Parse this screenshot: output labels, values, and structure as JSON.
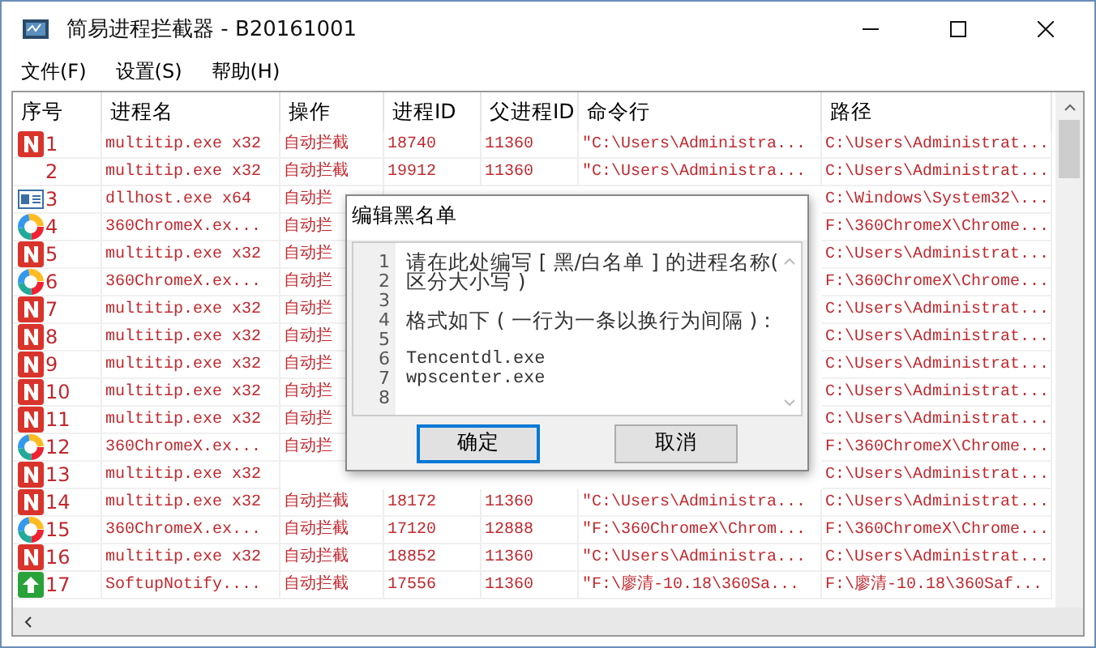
{
  "window": {
    "title": "简易进程拦截器 - B20161001"
  },
  "menu": [
    "文件(F)",
    "设置(S)",
    "帮助(H)"
  ],
  "table": {
    "columns": [
      "序号",
      "进程名",
      "操作",
      "进程ID",
      "父进程ID",
      "命令行",
      "路径"
    ],
    "rows": [
      {
        "kind": "n",
        "number": "1",
        "process": "multitip.exe x32",
        "action": "自动拦截",
        "pid": "18740",
        "parent_pid": "11360",
        "command": "\"C:\\Users\\Administra...",
        "path": "C:\\Users\\Administrat..."
      },
      {
        "kind": "plain",
        "number": "2",
        "process": "multitip.exe x32",
        "action": "自动拦截",
        "pid": "19912",
        "parent_pid": "11360",
        "command": "\"C:\\Users\\Administra...",
        "path": "C:\\Users\\Administrat..."
      },
      {
        "kind": "window",
        "number": "3",
        "process": "dllhost.exe x64",
        "action": "自动拦",
        "path": "C:\\Windows\\System32\\..."
      },
      {
        "kind": "ring",
        "number": "4",
        "process": "360ChromeX.ex...",
        "action": "自动拦",
        "path": "F:\\360ChromeX\\Chrome..."
      },
      {
        "kind": "n",
        "number": "5",
        "process": "multitip.exe x32",
        "action": "自动拦",
        "path": "C:\\Users\\Administrat..."
      },
      {
        "kind": "ring",
        "number": "6",
        "process": "360ChromeX.ex...",
        "action": "自动拦",
        "path": "F:\\360ChromeX\\Chrome..."
      },
      {
        "kind": "n",
        "number": "7",
        "process": "multitip.exe x32",
        "action": "自动拦",
        "path": "C:\\Users\\Administrat..."
      },
      {
        "kind": "n",
        "number": "8",
        "process": "multitip.exe x32",
        "action": "自动拦",
        "path": "C:\\Users\\Administrat..."
      },
      {
        "kind": "n",
        "number": "9",
        "process": "multitip.exe x32",
        "action": "自动拦",
        "path": "C:\\Users\\Administrat..."
      },
      {
        "kind": "n",
        "number": "10",
        "process": "multitip.exe x32",
        "action": "自动拦",
        "path": "C:\\Users\\Administrat..."
      },
      {
        "kind": "n",
        "number": "11",
        "process": "multitip.exe x32",
        "action": "自动拦",
        "path": "C:\\Users\\Administrat..."
      },
      {
        "kind": "ring",
        "number": "12",
        "process": "360ChromeX.ex...",
        "action": "自动拦",
        "path": "F:\\360ChromeX\\Chrome..."
      },
      {
        "kind": "n",
        "number": "13",
        "process": "multitip.exe x32",
        "path": "C:\\Users\\Administrat..."
      },
      {
        "kind": "n",
        "number": "14",
        "process": "multitip.exe x32",
        "action": "自动拦截",
        "pid": "18172",
        "parent_pid": "11360",
        "command": "\"C:\\Users\\Administra...",
        "path": "C:\\Users\\Administrat..."
      },
      {
        "kind": "ring",
        "number": "15",
        "process": "360ChromeX.ex...",
        "action": "自动拦截",
        "pid": "17120",
        "parent_pid": "12888",
        "command": "\"F:\\360ChromeX\\Chrom...",
        "path": "F:\\360ChromeX\\Chrome..."
      },
      {
        "kind": "n",
        "number": "16",
        "process": "multitip.exe x32",
        "action": "自动拦截",
        "pid": "18852",
        "parent_pid": "11360",
        "command": "\"C:\\Users\\Administra...",
        "path": "C:\\Users\\Administrat..."
      },
      {
        "kind": "arrow",
        "number": "17",
        "process": "SoftupNotify....",
        "action": "自动拦截",
        "pid": "17556",
        "parent_pid": "11360",
        "command": "\"F:\\廖清-10.18\\360Sa...",
        "path": "F:\\廖清-10.18\\360Saf..."
      }
    ]
  },
  "dialog": {
    "title": "编辑黑名单",
    "lines": [
      {
        "number": "1",
        "text": "请在此处编写 [ 黑/白名单 ] 的进程名称("
      },
      {
        "number": "2",
        "text": "区分大小写 )"
      },
      {
        "number": "3"
      },
      {
        "number": "4",
        "text": "格式如下 ( 一行为一条以换行为间隔 ) :"
      },
      {
        "number": "5"
      },
      {
        "number": "6",
        "text": "Tencentdl.exe"
      },
      {
        "number": "7",
        "text": "wpscenter.exe"
      },
      {
        "number": "8"
      }
    ],
    "buttons": [
      {
        "label": "确定",
        "default": true
      },
      {
        "label": "取消",
        "default": false
      }
    ]
  }
}
